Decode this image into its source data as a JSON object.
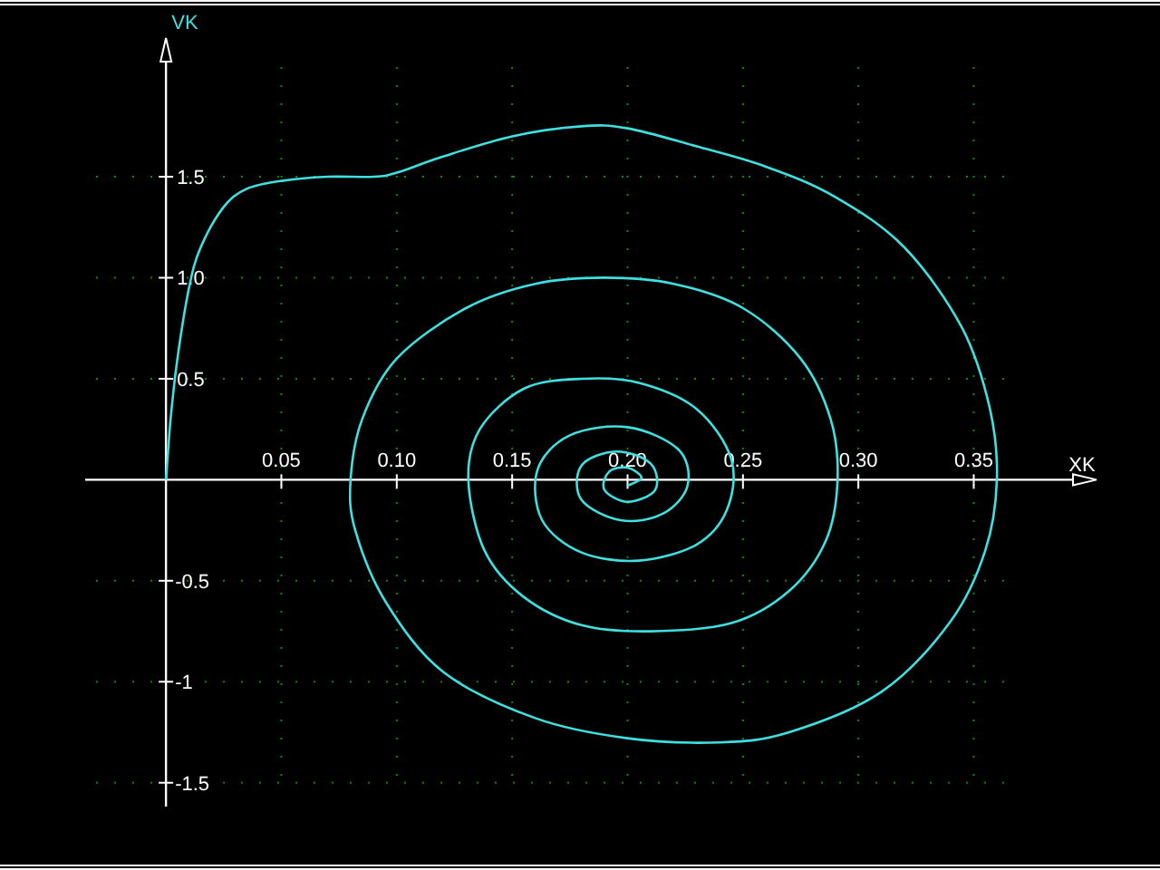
{
  "chart_data": {
    "type": "line",
    "xlabel": "XK",
    "ylabel": "VK",
    "x": [
      0,
      0.002,
      0.005,
      0.01,
      0.015,
      0.025,
      0.035,
      0.05,
      0.07,
      0.09,
      0.1,
      0.12,
      0.15,
      0.18,
      0.2,
      0.23,
      0.26,
      0.29,
      0.32,
      0.345,
      0.357,
      0.36,
      0.355,
      0.34,
      0.31,
      0.27,
      0.24,
      0.2,
      0.16,
      0.12,
      0.095,
      0.082,
      0.08,
      0.085,
      0.1,
      0.13,
      0.16,
      0.19,
      0.22,
      0.25,
      0.275,
      0.288,
      0.291,
      0.286,
      0.27,
      0.245,
      0.21,
      0.18,
      0.155,
      0.138,
      0.131,
      0.136,
      0.155,
      0.18,
      0.205,
      0.23,
      0.245,
      0.243,
      0.23,
      0.205,
      0.18,
      0.163,
      0.161,
      0.175,
      0.2,
      0.222,
      0.226,
      0.215,
      0.197,
      0.18,
      0.18,
      0.195,
      0.21,
      0.212,
      0.2,
      0.19,
      0.192,
      0.2,
      0.206,
      0.2
    ],
    "series": [
      {
        "color": "#40e0e0",
        "values": [
          0,
          0.3,
          0.6,
          0.95,
          1.15,
          1.35,
          1.44,
          1.48,
          1.5,
          1.5,
          1.52,
          1.6,
          1.7,
          1.75,
          1.74,
          1.65,
          1.55,
          1.4,
          1.15,
          0.75,
          0.35,
          0,
          -0.35,
          -0.7,
          -1.05,
          -1.25,
          -1.3,
          -1.28,
          -1.18,
          -0.95,
          -0.6,
          -0.25,
          0,
          0.3,
          0.6,
          0.85,
          0.97,
          1.0,
          0.97,
          0.85,
          0.6,
          0.3,
          0,
          -0.3,
          -0.55,
          -0.71,
          -0.75,
          -0.72,
          -0.58,
          -0.35,
          0,
          0.25,
          0.45,
          0.5,
          0.48,
          0.35,
          0.1,
          -0.15,
          -0.32,
          -0.4,
          -0.36,
          -0.2,
          0.05,
          0.22,
          0.26,
          0.15,
          -0.03,
          -0.17,
          -0.2,
          -0.1,
          0.07,
          0.14,
          0.08,
          -0.05,
          -0.11,
          -0.05,
          0.04,
          0.06,
          0.01,
          -0.03
        ]
      }
    ],
    "xlim": [
      -0.035,
      0.393
    ],
    "ylim": [
      -1.6,
      2.07
    ],
    "grid": true,
    "xticks": [
      {
        "value": 0.05,
        "label": "0.05"
      },
      {
        "value": 0.1,
        "label": "0.10"
      },
      {
        "value": 0.15,
        "label": "0.15"
      },
      {
        "value": 0.2,
        "label": "0.20"
      },
      {
        "value": 0.25,
        "label": "0.25"
      },
      {
        "value": 0.3,
        "label": "0.30"
      },
      {
        "value": 0.35,
        "label": "0.35"
      }
    ],
    "yticks": [
      {
        "value": 1.5,
        "label": "1.5"
      },
      {
        "value": 1.0,
        "label": "1.0"
      },
      {
        "value": 0.5,
        "label": "0.5"
      },
      {
        "value": -0.5,
        "label": "-0.5"
      },
      {
        "value": -1,
        "label": "-1"
      },
      {
        "value": -1.5,
        "label": "-1.5"
      }
    ]
  }
}
